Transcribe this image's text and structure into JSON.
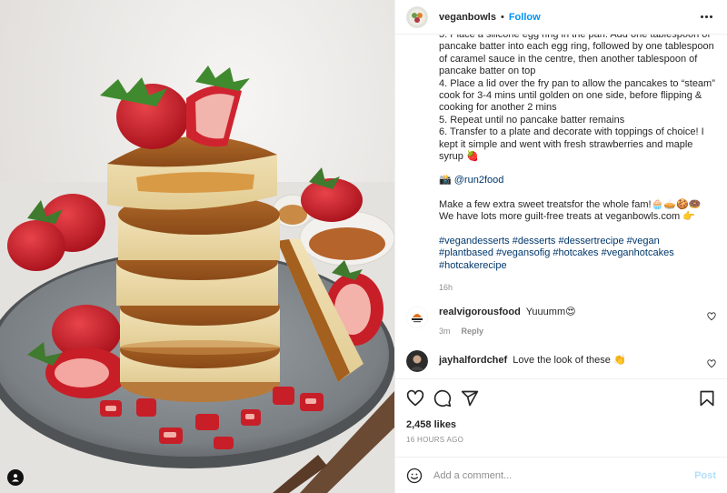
{
  "post": {
    "username": "veganbowls",
    "separator": "•",
    "follow_label": "Follow",
    "caption_lines": [
      "3. Place a silicone egg ring in the pan. Add one tablespoon of pancake batter into each egg ring, followed by one tablespoon of caramel sauce in the centre, then another tablespoon of pancake batter on top",
      "4. Place a lid over the fry pan to allow the pancakes to “steam” cook for 3-4 mins until golden on one side, before flipping & cooking for another 2 mins",
      "5. Repeat until no pancake batter remains",
      "6. Transfer to a plate and decorate with toppings of choice! I kept it simple and went with fresh strawberries and maple syrup 🍓"
    ],
    "credit_emoji": "📸",
    "credit_handle": "@run2food",
    "promo_text": "Make a few extra sweet treatsfor the whole fam!🧁🥧🍪🍩 We have lots more guilt-free treats at veganbowls.com 👉",
    "hashtags": "#vegandesserts #desserts #dessertrecipe #vegan #plantbased #vegansofig #hotcakes #veganhotcakes #hotcakerecipe",
    "caption_time": "16h"
  },
  "comments": [
    {
      "username": "realvigorousfood",
      "text": "Yuuumm😍",
      "time": "3m",
      "reply_label": "Reply",
      "avatar_icon": "brand-logo-icon"
    },
    {
      "username": "jayhalfordchef",
      "text": "Love the look of these 👏",
      "avatar_icon": "profile-photo-icon"
    }
  ],
  "actions": {
    "likes": "2,458 likes",
    "time_ago": "16 HOURS AGO",
    "icons": [
      "heart-icon",
      "comment-icon",
      "share-icon",
      "bookmark-icon"
    ]
  },
  "composer": {
    "placeholder": "Add a comment...",
    "post_label": "Post"
  },
  "colors": {
    "follow": "#0095f6",
    "hashtag": "#00376b",
    "muted": "#8e8e8e",
    "post_disabled": "#b2dffc"
  }
}
